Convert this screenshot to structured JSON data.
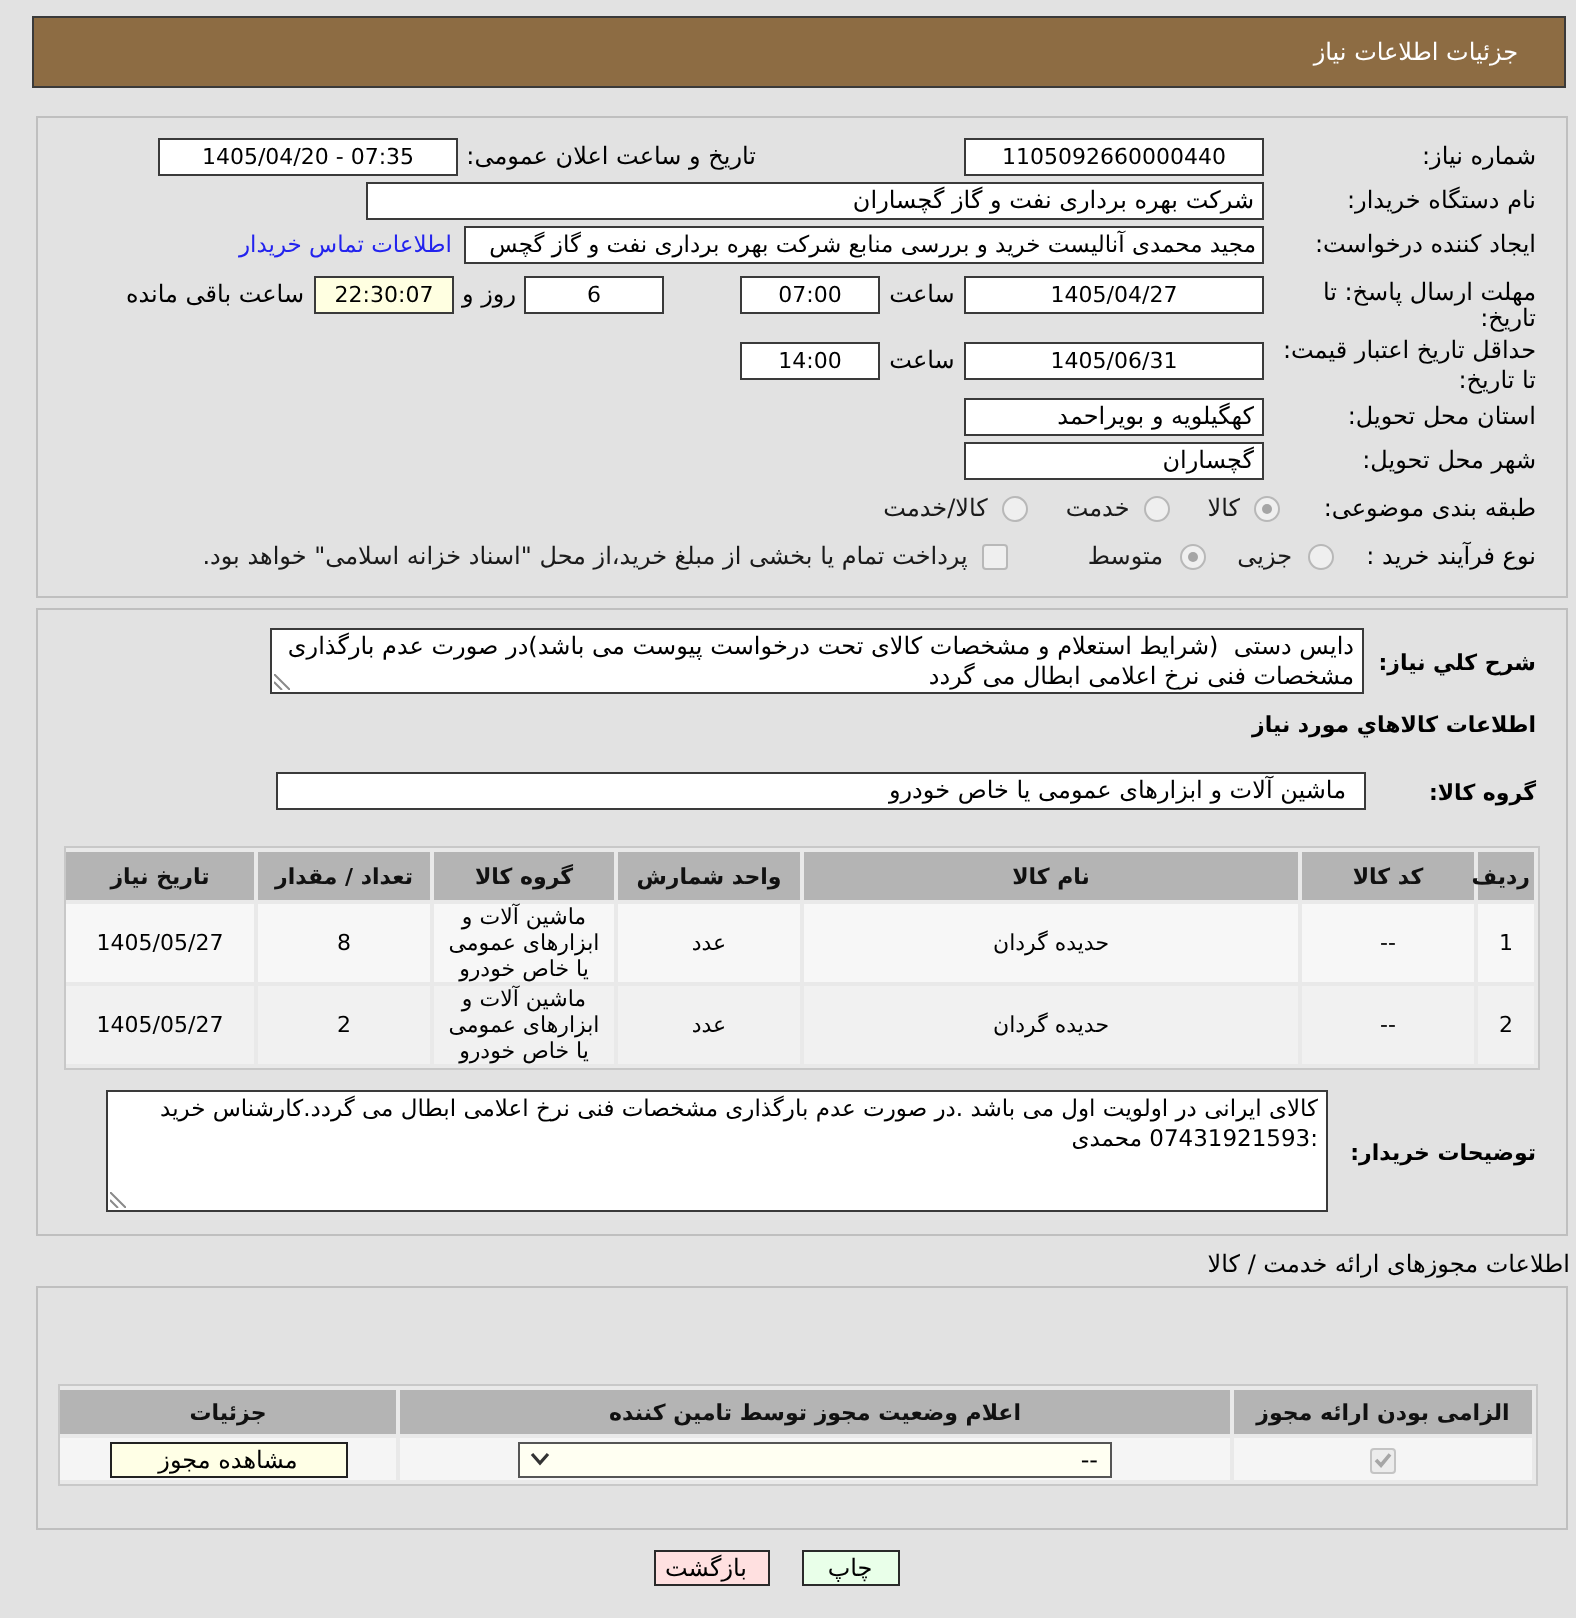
{
  "header": {
    "title": "جزئیات اطلاعات نیاز"
  },
  "details": {
    "need_number": {
      "label": "شماره نیاز:",
      "value": "1105092660000440"
    },
    "announcement": {
      "label": "تاریخ و ساعت اعلان عمومی:",
      "value": "1405/04/20 - 07:35"
    },
    "buyer": {
      "label": "نام دستگاه خریدار:",
      "value": "شرکت بهره برداری نفت و گاز گچساران"
    },
    "requester": {
      "label": "ایجاد کننده درخواست:",
      "value": "مجید محمدی آنالیست خرید و بررسی منابع شرکت بهره برداری نفت و گاز گچس",
      "link": "اطلاعات تماس خریدار"
    },
    "reply_deadline": {
      "label": "مهلت ارسال پاسخ: تا تاریخ:",
      "date": "1405/04/27",
      "time_label": "ساعت",
      "time": "07:00",
      "days": "6",
      "days_label": "روز و",
      "remaining": "22:30:07",
      "remaining_label": "ساعت باقی مانده"
    },
    "price_validity": {
      "label": "حداقل تاریخ اعتبار قیمت: تا تاریخ:",
      "date": "1405/06/31",
      "time_label": "ساعت",
      "time": "14:00"
    },
    "province": {
      "label": "استان محل تحویل:",
      "value": "کهگیلویه و بویراحمد"
    },
    "city": {
      "label": "شهر محل تحویل:",
      "value": "گچساران"
    },
    "category": {
      "label": "طبقه بندی موضوعی:",
      "options": [
        {
          "label": "کالا",
          "selected": true
        },
        {
          "label": "خدمت",
          "selected": false
        },
        {
          "label": "کالا/خدمت",
          "selected": false
        }
      ]
    },
    "process": {
      "label": "نوع فرآیند خرید :",
      "options": [
        {
          "label": "جزیی",
          "selected": false
        },
        {
          "label": "متوسط",
          "selected": true
        }
      ],
      "treasury": {
        "label": "پرداخت تمام یا بخشی از مبلغ خرید،از محل \"اسناد خزانه اسلامی\" خواهد بود.",
        "checked": false
      }
    }
  },
  "items": {
    "description": {
      "label": "شرح کلي نياز:",
      "value": "دایس دستی  (شرایط استعلام و مشخصات کالای تحت درخواست پیوست می باشد)در صورت عدم بارگذاری مشخصات فنی نرخ اعلامی ابطال می گردد"
    },
    "title": "اطلاعات کالاهاي مورد نياز",
    "group": {
      "label": "گروه کالا:",
      "value": "ماشین آلات و ابزارهای عمومی یا خاص خودرو"
    },
    "table": {
      "columns": [
        "ردیف",
        "کد کالا",
        "نام کالا",
        "واحد شمارش",
        "گروه کالا",
        "تعداد / مقدار",
        "تاریخ نیاز"
      ],
      "rows": [
        [
          "1",
          "--",
          "حدیده گردان",
          "عدد",
          "ماشین آلات و ابزارهای عمومی یا خاص خودرو",
          "8",
          "1405/05/27"
        ],
        [
          "2",
          "--",
          "حدیده گردان",
          "عدد",
          "ماشین آلات و ابزارهای عمومی یا خاص خودرو",
          "2",
          "1405/05/27"
        ]
      ]
    },
    "buyer_notes": {
      "label": "توضیحات خریدار:",
      "value": "کالای ایرانی در اولویت اول می باشد .در صورت عدم بارگذاری مشخصات فنی نرخ اعلامی ابطال می گردد.کارشناس خرید :07431921593 محمدی"
    }
  },
  "licenses": {
    "title": "اطلاعات مجوزهای ارائه خدمت / کالا",
    "columns": [
      "الزامی بودن ارائه مجوز",
      "اعلام وضعیت مجوز توسط تامین کننده",
      "جزئیات"
    ],
    "rows": [
      {
        "required": true,
        "status": "--",
        "action": "مشاهده مجوز"
      }
    ]
  },
  "buttons": [
    {
      "label": "چاپ",
      "kind": "print"
    },
    {
      "label": "بازگشت",
      "kind": "back"
    }
  ]
}
